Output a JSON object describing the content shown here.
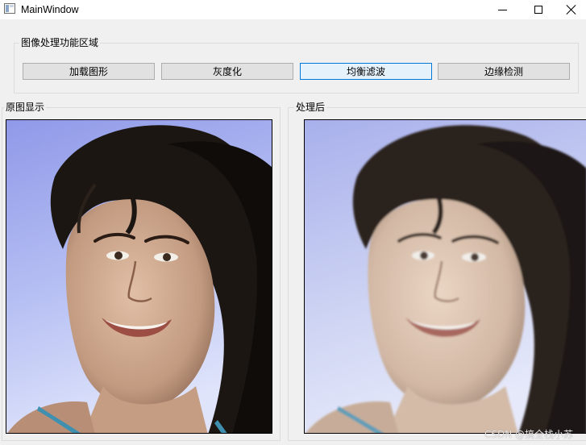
{
  "window": {
    "title": "MainWindow",
    "controls": [
      "minimize-icon",
      "maximize-icon",
      "close-icon"
    ]
  },
  "function_area": {
    "title": "图像处理功能区域",
    "buttons": [
      {
        "label": "加载图形"
      },
      {
        "label": "灰度化"
      },
      {
        "label": "均衡滤波",
        "focused": true
      },
      {
        "label": "边缘检测"
      }
    ]
  },
  "original_panel": {
    "title": "原图显示"
  },
  "processed_panel": {
    "title": "处理后"
  },
  "watermark": "CSDN @搞全栈小苏",
  "colors": {
    "background": "#f0f0f0",
    "button_face": "#e1e1e1",
    "button_focus_border": "#0078d7",
    "button_focus_fill": "#e5f1fb",
    "original_backdrop": "#a9b2f0",
    "processed_backdrop": "#c0c8ef"
  }
}
